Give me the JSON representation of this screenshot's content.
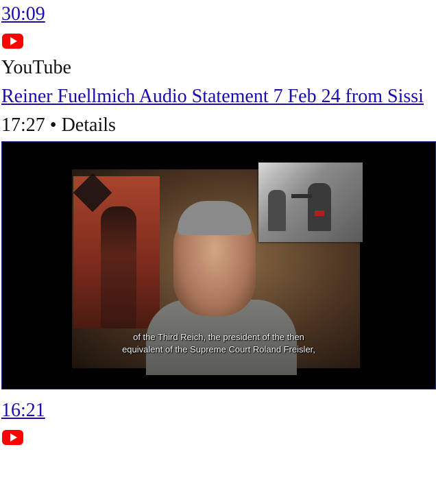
{
  "items": [
    {
      "duration": "30:09",
      "source_icon": "youtube-icon"
    },
    {
      "source": "YouTube",
      "title": "Reiner Fuellmich Audio Statement 7 Feb 24 from Sissi",
      "meta": "17:27 • Details",
      "thumbnail": {
        "subtitle_line1": "of the Third Reich, the president of the then",
        "subtitle_line2": "equivalent of the Supreme Court Roland Freisler,"
      }
    },
    {
      "duration": "16:21",
      "source_icon": "youtube-icon"
    }
  ],
  "colors": {
    "link": "#1a0dab",
    "youtube_red": "#ff0000"
  }
}
